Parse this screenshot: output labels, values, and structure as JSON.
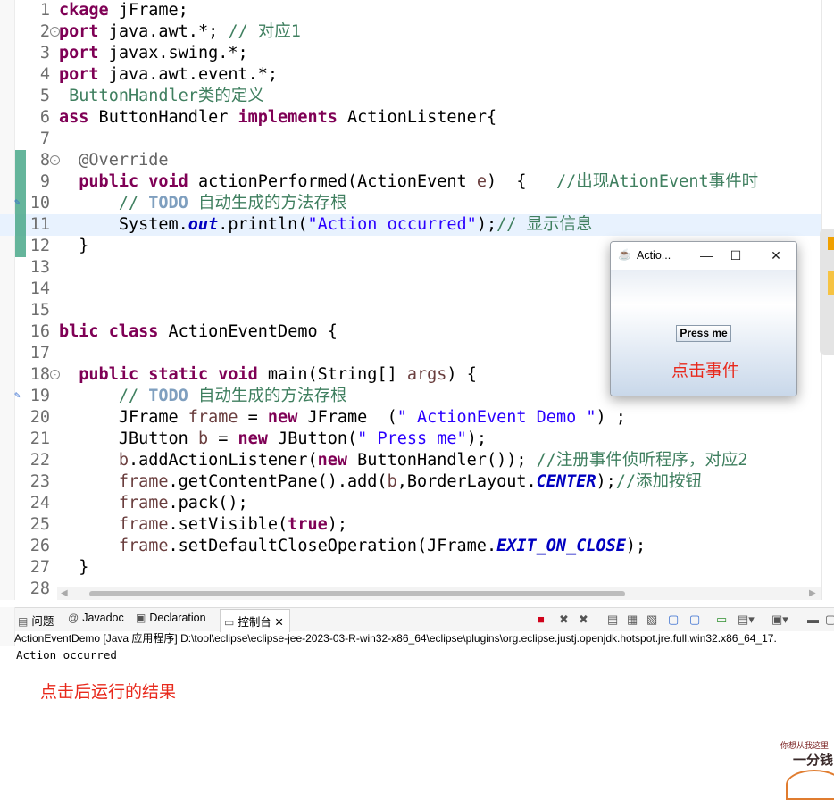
{
  "editor": {
    "lines": [
      {
        "n": "1",
        "fold": false,
        "segs": [
          {
            "t": "ckage",
            "c": "kw"
          },
          {
            "t": " jFrame;",
            "c": ""
          }
        ]
      },
      {
        "n": "2",
        "fold": true,
        "segs": [
          {
            "t": "port",
            "c": "kw"
          },
          {
            "t": " java.awt.*; ",
            "c": ""
          },
          {
            "t": "// 对应1",
            "c": "cm"
          }
        ]
      },
      {
        "n": "3",
        "fold": false,
        "segs": [
          {
            "t": "port",
            "c": "kw"
          },
          {
            "t": " javax.swing.*;",
            "c": ""
          }
        ]
      },
      {
        "n": "4",
        "fold": false,
        "segs": [
          {
            "t": "port",
            "c": "kw"
          },
          {
            "t": " java.awt.event.*;",
            "c": ""
          }
        ]
      },
      {
        "n": "5",
        "fold": false,
        "segs": [
          {
            "t": " ButtonHandler类的定义",
            "c": "cm"
          }
        ]
      },
      {
        "n": "6",
        "fold": false,
        "segs": [
          {
            "t": "ass",
            "c": "kw"
          },
          {
            "t": " ButtonHandler ",
            "c": ""
          },
          {
            "t": "implements",
            "c": "kw"
          },
          {
            "t": " ActionListener{",
            "c": ""
          }
        ]
      },
      {
        "n": "7",
        "fold": false,
        "segs": []
      },
      {
        "n": "8",
        "fold": true,
        "segs": [
          {
            "t": "  @Override",
            "c": "an"
          }
        ]
      },
      {
        "n": "9",
        "fold": false,
        "segs": [
          {
            "t": "  ",
            "c": ""
          },
          {
            "t": "public",
            "c": "kw"
          },
          {
            "t": " ",
            "c": ""
          },
          {
            "t": "void",
            "c": "kw"
          },
          {
            "t": " actionPerformed(ActionEvent ",
            "c": ""
          },
          {
            "t": "e",
            "c": "var"
          },
          {
            "t": ")  {   ",
            "c": ""
          },
          {
            "t": "//出现AtionEvent事件时",
            "c": "cm"
          }
        ]
      },
      {
        "n": "10",
        "fold": false,
        "segs": [
          {
            "t": "      ",
            "c": ""
          },
          {
            "t": "// ",
            "c": "cm"
          },
          {
            "t": "TODO",
            "c": "todo"
          },
          {
            "t": " 自动生成的方法存根",
            "c": "cm"
          }
        ]
      },
      {
        "n": "11",
        "fold": false,
        "hl": true,
        "segs": [
          {
            "t": "      System.",
            "c": ""
          },
          {
            "t": "out",
            "c": "fld"
          },
          {
            "t": ".println(",
            "c": ""
          },
          {
            "t": "\"Action occurred\"",
            "c": "str"
          },
          {
            "t": ");",
            "c": ""
          },
          {
            "t": "// 显示信息",
            "c": "cm"
          }
        ]
      },
      {
        "n": "12",
        "fold": false,
        "segs": [
          {
            "t": "  }",
            "c": ""
          }
        ]
      },
      {
        "n": "13",
        "fold": false,
        "segs": []
      },
      {
        "n": "14",
        "fold": false,
        "segs": []
      },
      {
        "n": "15",
        "fold": false,
        "segs": []
      },
      {
        "n": "16",
        "fold": false,
        "segs": [
          {
            "t": "blic",
            "c": "kw"
          },
          {
            "t": " ",
            "c": ""
          },
          {
            "t": "class",
            "c": "kw"
          },
          {
            "t": " ActionEventDemo {",
            "c": ""
          }
        ]
      },
      {
        "n": "17",
        "fold": false,
        "segs": []
      },
      {
        "n": "18",
        "fold": true,
        "segs": [
          {
            "t": "  ",
            "c": ""
          },
          {
            "t": "public",
            "c": "kw"
          },
          {
            "t": " ",
            "c": ""
          },
          {
            "t": "static",
            "c": "kw"
          },
          {
            "t": " ",
            "c": ""
          },
          {
            "t": "void",
            "c": "kw"
          },
          {
            "t": " main(String[] ",
            "c": ""
          },
          {
            "t": "args",
            "c": "var"
          },
          {
            "t": ") {",
            "c": ""
          }
        ]
      },
      {
        "n": "19",
        "fold": false,
        "segs": [
          {
            "t": "      ",
            "c": ""
          },
          {
            "t": "// ",
            "c": "cm"
          },
          {
            "t": "TODO",
            "c": "todo"
          },
          {
            "t": " 自动生成的方法存根",
            "c": "cm"
          }
        ]
      },
      {
        "n": "20",
        "fold": false,
        "segs": [
          {
            "t": "      JFrame ",
            "c": ""
          },
          {
            "t": "frame",
            "c": "var"
          },
          {
            "t": " = ",
            "c": ""
          },
          {
            "t": "new",
            "c": "kw"
          },
          {
            "t": " JFrame  (",
            "c": ""
          },
          {
            "t": "\" ActionEvent Demo \"",
            "c": "str"
          },
          {
            "t": ") ;",
            "c": ""
          }
        ]
      },
      {
        "n": "21",
        "fold": false,
        "segs": [
          {
            "t": "      JButton ",
            "c": ""
          },
          {
            "t": "b",
            "c": "var"
          },
          {
            "t": " = ",
            "c": ""
          },
          {
            "t": "new",
            "c": "kw"
          },
          {
            "t": " JButton(",
            "c": ""
          },
          {
            "t": "\" Press me\"",
            "c": "str"
          },
          {
            "t": ");",
            "c": ""
          }
        ]
      },
      {
        "n": "22",
        "fold": false,
        "segs": [
          {
            "t": "      ",
            "c": ""
          },
          {
            "t": "b",
            "c": "var"
          },
          {
            "t": ".addActionListener(",
            "c": ""
          },
          {
            "t": "new",
            "c": "kw"
          },
          {
            "t": " ButtonHandler()); ",
            "c": ""
          },
          {
            "t": "//注册事件侦听程序，对应2",
            "c": "cm"
          }
        ]
      },
      {
        "n": "23",
        "fold": false,
        "segs": [
          {
            "t": "      ",
            "c": ""
          },
          {
            "t": "frame",
            "c": "var"
          },
          {
            "t": ".getContentPane().add(",
            "c": ""
          },
          {
            "t": "b",
            "c": "var"
          },
          {
            "t": ",BorderLayout.",
            "c": ""
          },
          {
            "t": "CENTER",
            "c": "fld"
          },
          {
            "t": ");",
            "c": ""
          },
          {
            "t": "//添加按钮",
            "c": "cm"
          }
        ]
      },
      {
        "n": "24",
        "fold": false,
        "segs": [
          {
            "t": "      ",
            "c": ""
          },
          {
            "t": "frame",
            "c": "var"
          },
          {
            "t": ".pack();",
            "c": ""
          }
        ]
      },
      {
        "n": "25",
        "fold": false,
        "segs": [
          {
            "t": "      ",
            "c": ""
          },
          {
            "t": "frame",
            "c": "var"
          },
          {
            "t": ".setVisible(",
            "c": ""
          },
          {
            "t": "true",
            "c": "kw"
          },
          {
            "t": ");",
            "c": ""
          }
        ]
      },
      {
        "n": "26",
        "fold": false,
        "segs": [
          {
            "t": "      ",
            "c": ""
          },
          {
            "t": "frame",
            "c": "var"
          },
          {
            "t": ".setDefaultCloseOperation(JFrame.",
            "c": ""
          },
          {
            "t": "EXIT_ON_CLOSE",
            "c": "fld"
          },
          {
            "t": ");",
            "c": ""
          }
        ]
      },
      {
        "n": "27",
        "fold": false,
        "segs": [
          {
            "t": "  }",
            "c": ""
          }
        ]
      },
      {
        "n": "28",
        "fold": false,
        "segs": []
      }
    ]
  },
  "popup": {
    "title": "Actio...",
    "minimize": "—",
    "maximize": "☐",
    "close": "✕",
    "button_label": "Press me",
    "annotation": "点击事件"
  },
  "tabs": {
    "problems": "问题",
    "javadoc": "Javadoc",
    "declaration": "Declaration",
    "console": "控制台",
    "console_close": "✕"
  },
  "console": {
    "header": "ActionEventDemo [Java 应用程序] D:\\tool\\eclipse\\eclipse-jee-2023-03-R-win32-x86_64\\eclipse\\plugins\\org.eclipse.justj.openjdk.hotspot.jre.full.win32.x86_64_17.",
    "output": "Action occurred",
    "annotation": "点击后运行的结果"
  },
  "watermark": {
    "line1": "你想从我这里",
    "line2": "一分钱"
  },
  "colors": {
    "keyword": "#7f0055",
    "comment": "#3f7f5f",
    "string": "#2a00ff",
    "annotation_red": "#e8291c",
    "highlight_line": "#e8f2fe"
  }
}
